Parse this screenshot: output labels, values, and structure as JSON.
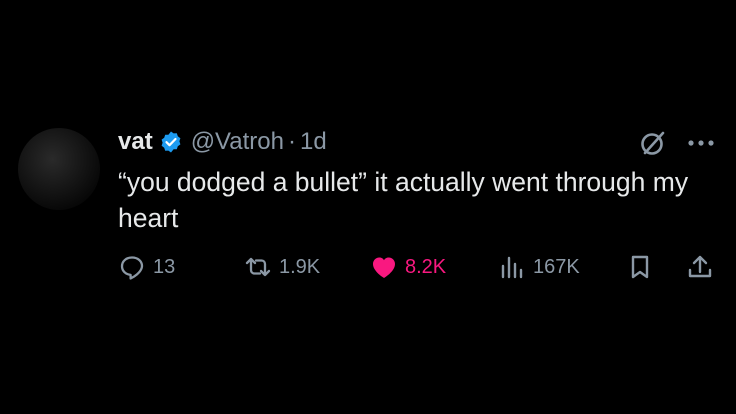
{
  "tweet": {
    "author_name": "vat",
    "handle": "@Vatroh",
    "separator": "·",
    "time": "1d",
    "text": "“you dodged a bullet” it actually went through my heart",
    "stats": {
      "replies": "13",
      "reposts": "1.9K",
      "likes": "8.2K",
      "views": "167K"
    }
  },
  "colors": {
    "background": "#000000",
    "text": "#e7e9ea",
    "muted": "#8b98a5",
    "verified": "#1d9bf0",
    "like": "#f91880"
  },
  "icons": [
    "verified-badge-icon",
    "grok-icon",
    "more-icon",
    "reply-icon",
    "repost-icon",
    "like-heart-icon",
    "views-icon",
    "bookmark-icon",
    "share-icon"
  ]
}
